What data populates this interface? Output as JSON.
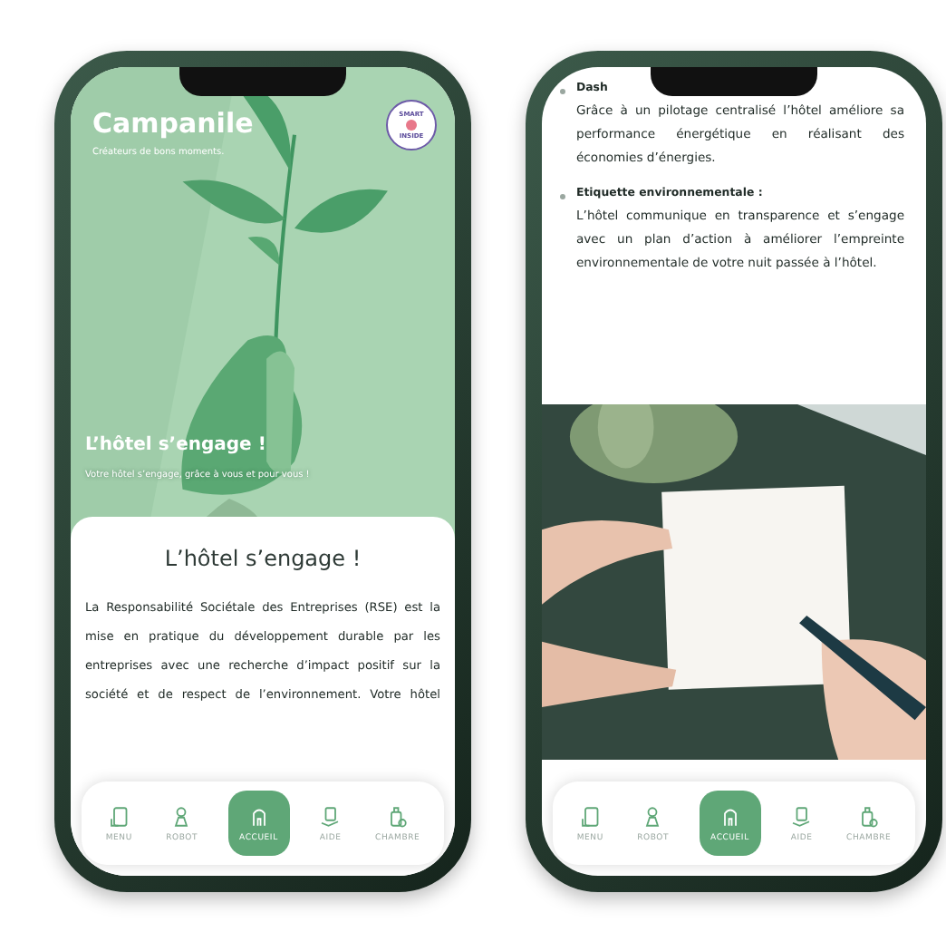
{
  "home_screen": {
    "brand": "Campanile",
    "tagline": "Créateurs de bons moments.",
    "badge": {
      "top": "SMART",
      "bottom": "INSIDE"
    },
    "hero": {
      "kind": "picture",
      "title": "L’hôtel s’engage !",
      "subtitle": "Votre hôtel s’engage, grâce à vous et pour vous !"
    },
    "card": {
      "title": "L’hôtel s’engage !",
      "paragraph": "La Responsabilité Sociétale des Entreprises (RSE) est la mise en pratique du développement durable par les entreprises avec une recherche d’impact positif sur la société et de respect de l’environnement. Votre hôtel"
    },
    "nav": [
      {
        "label": "MENU",
        "selected": false
      },
      {
        "label": "ROBOT",
        "selected": false
      },
      {
        "label": "ACCUEIL",
        "selected": true
      },
      {
        "label": "AIDE",
        "selected": false
      },
      {
        "label": "CHAMBRE",
        "selected": false
      }
    ]
  },
  "detail_screen": {
    "bullets": [
      {
        "title": "Dash",
        "text": "Grâce à un pilotage centralisé l’hôtel améliore sa performance énergétique en réalisant des économies d’énergies."
      },
      {
        "title": "Etiquette environnementale :",
        "text": "L’hôtel communique en transparence et s’engage avec un plan d’action à améliorer l’empreinte environnementale de votre nuit passée à l’hôtel."
      }
    ],
    "nav": [
      {
        "label": "MENU",
        "selected": false
      },
      {
        "label": "ROBOT",
        "selected": false
      },
      {
        "label": "ACCUEIL",
        "selected": true
      },
      {
        "label": "AIDE",
        "selected": false
      },
      {
        "label": "CHAMBRE",
        "selected": false
      }
    ]
  }
}
